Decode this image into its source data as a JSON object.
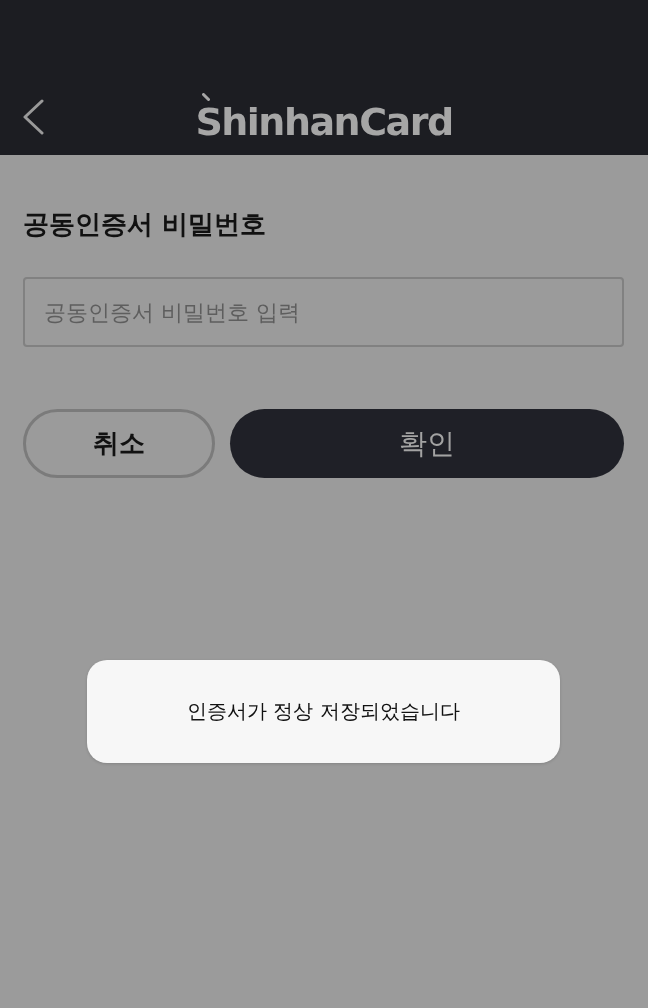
{
  "header": {
    "logo": "ShinhanCard"
  },
  "title": "공동인증서 비밀번호",
  "password_field": {
    "placeholder": "공동인증서 비밀번호 입력"
  },
  "buttons": [
    {
      "label": "취소",
      "kind": "secondary"
    },
    {
      "label": "확인",
      "kind": "primary"
    }
  ],
  "toast": {
    "message": "인증서가 정상 저장되었습니다",
    "backdrop": true
  }
}
